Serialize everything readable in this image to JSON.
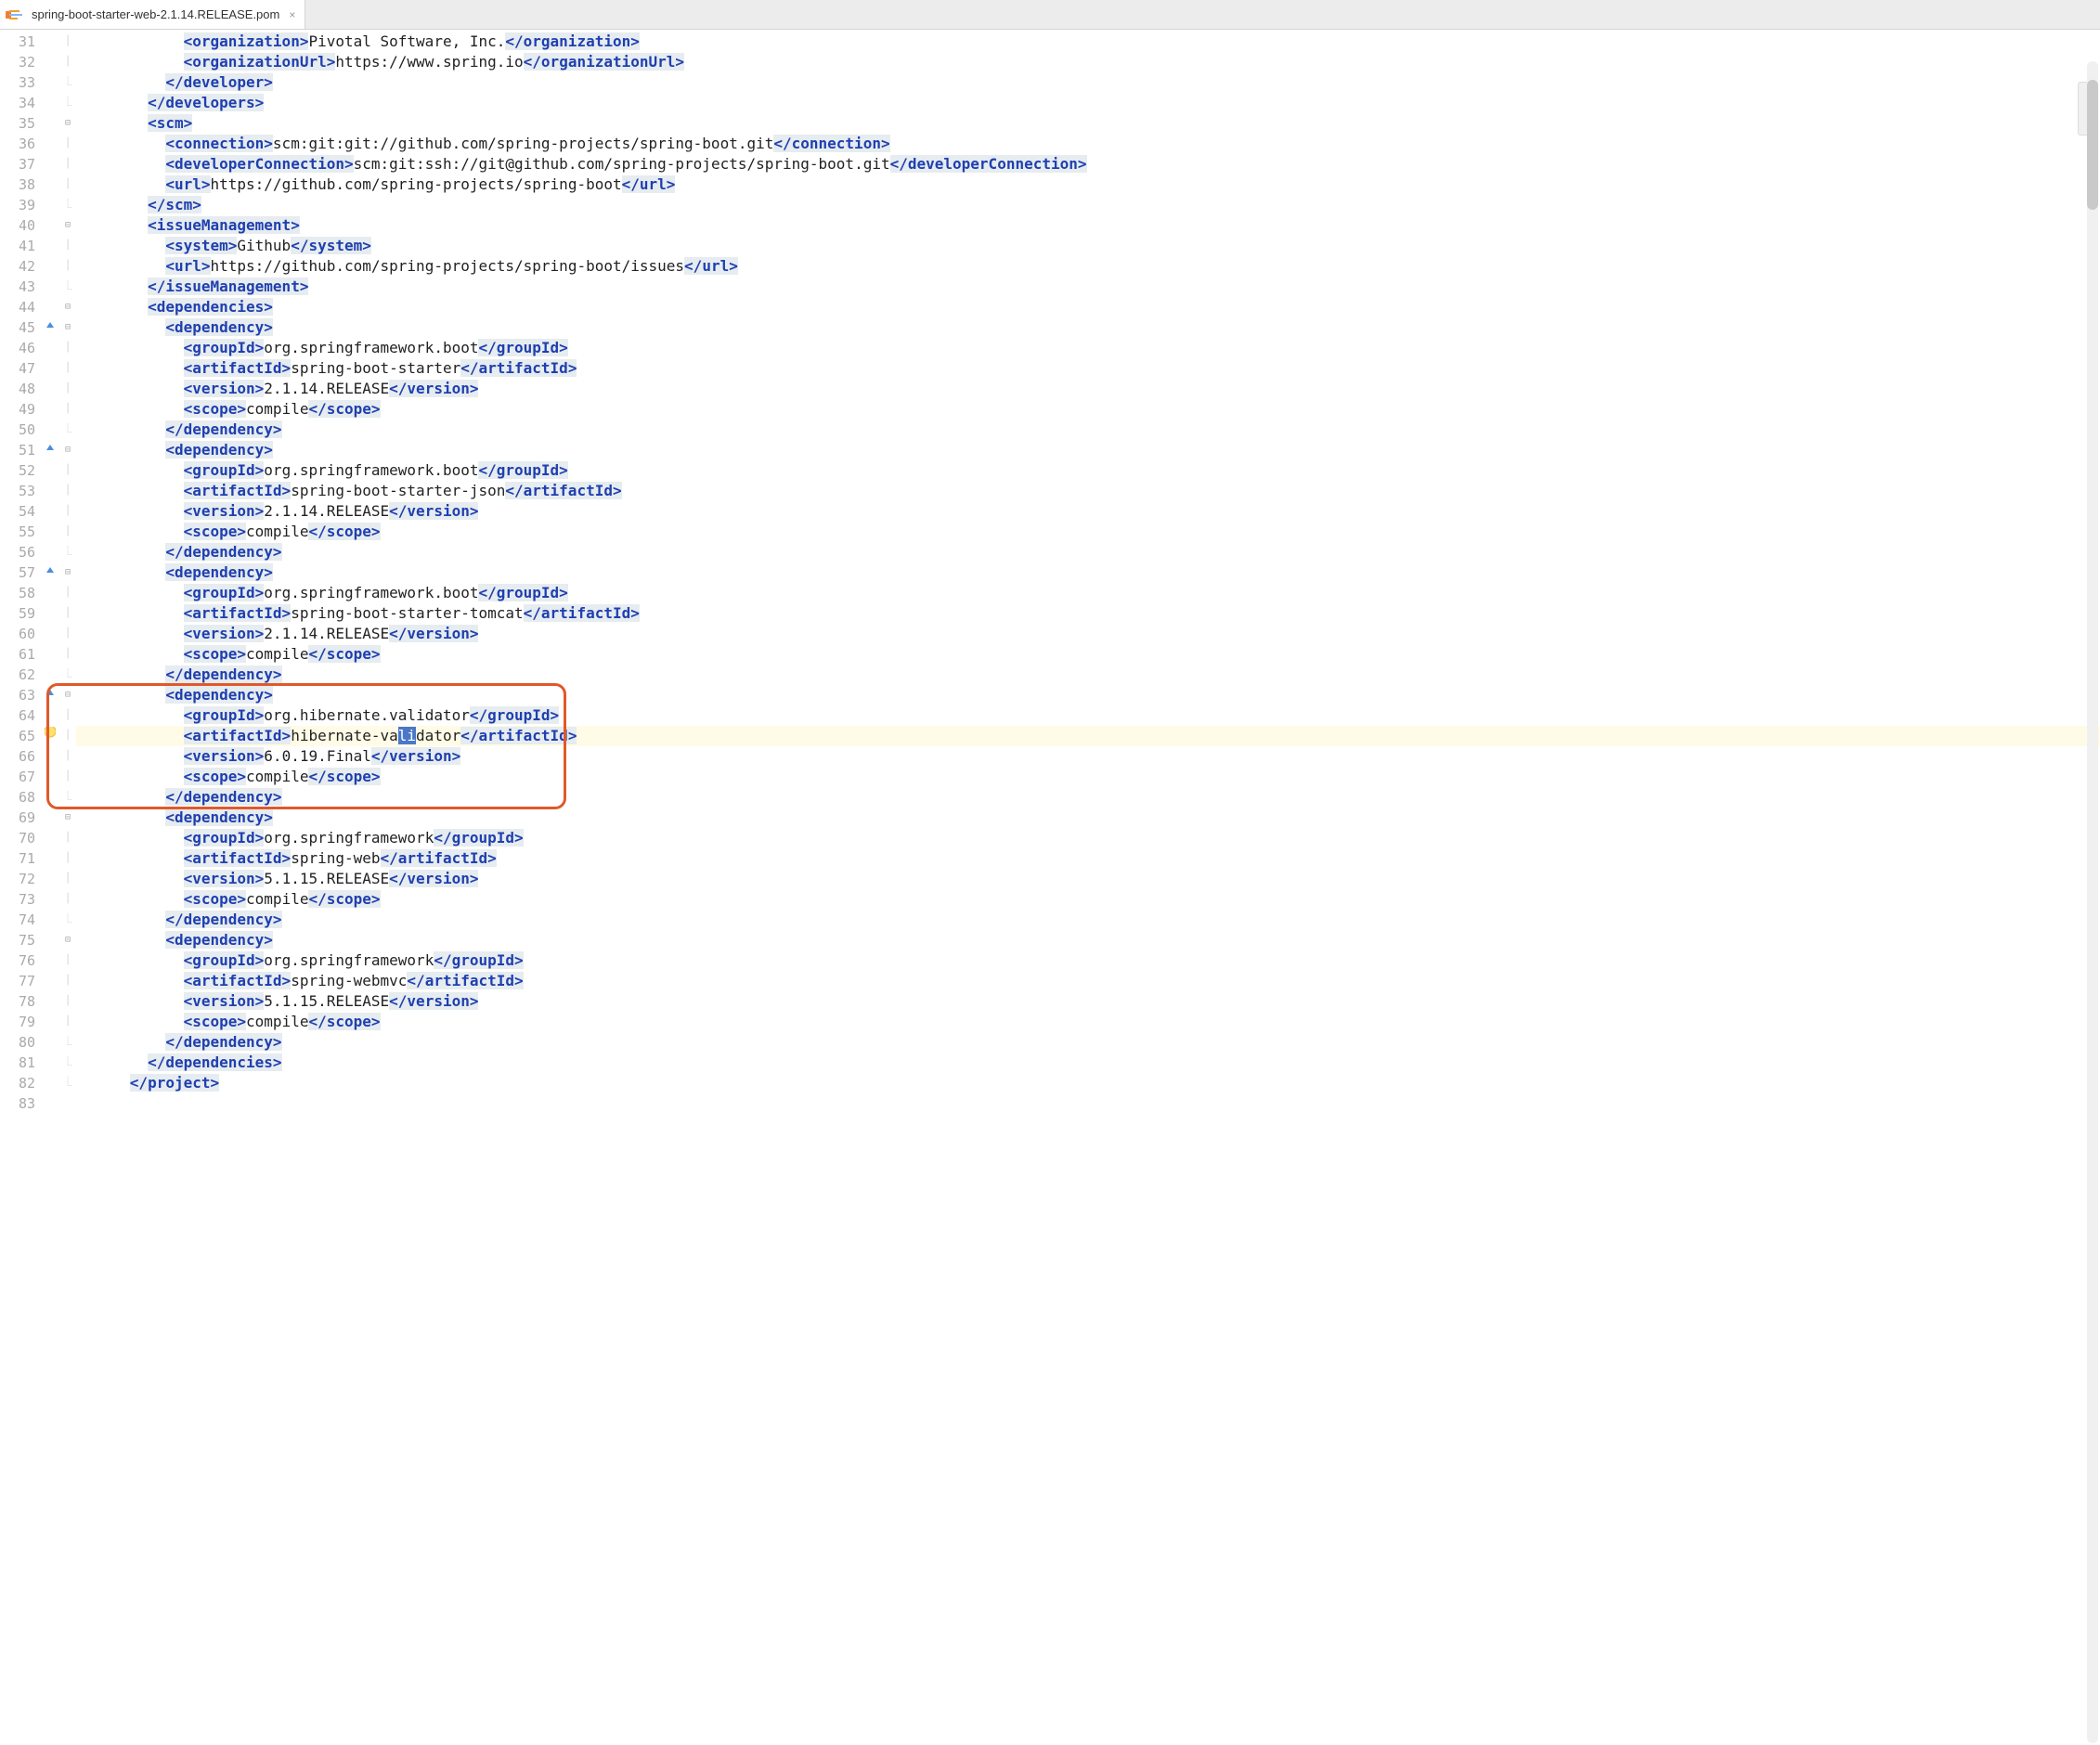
{
  "tab": {
    "title": "spring-boot-starter-web-2.1.14.RELEASE.pom"
  },
  "lines": [
    {
      "n": 31,
      "ind": 6,
      "marker": "",
      "fold": "│",
      "segs": [
        {
          "t": "tag",
          "v": "<organization>"
        },
        {
          "t": "txt",
          "v": "Pivotal Software, Inc."
        },
        {
          "t": "tag",
          "v": "</organization>"
        }
      ]
    },
    {
      "n": 32,
      "ind": 6,
      "marker": "",
      "fold": "│",
      "segs": [
        {
          "t": "tag",
          "v": "<organizationUrl>"
        },
        {
          "t": "txt",
          "v": "https://www.spring.io"
        },
        {
          "t": "tag",
          "v": "</organizationUrl>"
        }
      ]
    },
    {
      "n": 33,
      "ind": 5,
      "marker": "",
      "fold": "└",
      "segs": [
        {
          "t": "tag",
          "v": "</developer>"
        }
      ]
    },
    {
      "n": 34,
      "ind": 4,
      "marker": "",
      "fold": "└",
      "segs": [
        {
          "t": "tag",
          "v": "</developers>"
        }
      ]
    },
    {
      "n": 35,
      "ind": 4,
      "marker": "",
      "fold": "▼",
      "segs": [
        {
          "t": "tag",
          "v": "<scm>"
        }
      ]
    },
    {
      "n": 36,
      "ind": 5,
      "marker": "",
      "fold": "│",
      "segs": [
        {
          "t": "tag",
          "v": "<connection>"
        },
        {
          "t": "txt",
          "v": "scm:git:git://github.com/spring-projects/spring-boot.git"
        },
        {
          "t": "tag",
          "v": "</connection>"
        }
      ]
    },
    {
      "n": 37,
      "ind": 5,
      "marker": "",
      "fold": "│",
      "segs": [
        {
          "t": "tag",
          "v": "<developerConnection>"
        },
        {
          "t": "txt",
          "v": "scm:git:ssh://git@github.com/spring-projects/spring-boot.git"
        },
        {
          "t": "tag",
          "v": "</developerConnection>"
        }
      ]
    },
    {
      "n": 38,
      "ind": 5,
      "marker": "",
      "fold": "│",
      "segs": [
        {
          "t": "tag",
          "v": "<url>"
        },
        {
          "t": "txt",
          "v": "https://github.com/spring-projects/spring-boot"
        },
        {
          "t": "tag",
          "v": "</url>"
        }
      ]
    },
    {
      "n": 39,
      "ind": 4,
      "marker": "",
      "fold": "└",
      "segs": [
        {
          "t": "tag",
          "v": "</scm>"
        }
      ]
    },
    {
      "n": 40,
      "ind": 4,
      "marker": "",
      "fold": "▼",
      "segs": [
        {
          "t": "tag",
          "v": "<issueManagement>"
        }
      ]
    },
    {
      "n": 41,
      "ind": 5,
      "marker": "",
      "fold": "│",
      "segs": [
        {
          "t": "tag",
          "v": "<system>"
        },
        {
          "t": "txt",
          "v": "Github"
        },
        {
          "t": "tag",
          "v": "</system>"
        }
      ]
    },
    {
      "n": 42,
      "ind": 5,
      "marker": "",
      "fold": "│",
      "segs": [
        {
          "t": "tag",
          "v": "<url>"
        },
        {
          "t": "txt",
          "v": "https://github.com/spring-projects/spring-boot/issues"
        },
        {
          "t": "tag",
          "v": "</url>"
        }
      ]
    },
    {
      "n": 43,
      "ind": 4,
      "marker": "",
      "fold": "└",
      "segs": [
        {
          "t": "tag",
          "v": "</issueManagement>"
        }
      ]
    },
    {
      "n": 44,
      "ind": 4,
      "marker": "",
      "fold": "▼",
      "segs": [
        {
          "t": "tag",
          "v": "<dependencies>"
        }
      ]
    },
    {
      "n": 45,
      "ind": 5,
      "marker": "up",
      "fold": "▼",
      "segs": [
        {
          "t": "tag",
          "v": "<dependency>"
        }
      ]
    },
    {
      "n": 46,
      "ind": 6,
      "marker": "",
      "fold": "│",
      "segs": [
        {
          "t": "tag",
          "v": "<groupId>"
        },
        {
          "t": "txt",
          "v": "org.springframework.boot"
        },
        {
          "t": "tag",
          "v": "</groupId>"
        }
      ]
    },
    {
      "n": 47,
      "ind": 6,
      "marker": "",
      "fold": "│",
      "segs": [
        {
          "t": "tag",
          "v": "<artifactId>"
        },
        {
          "t": "txt",
          "v": "spring-boot-starter"
        },
        {
          "t": "tag",
          "v": "</artifactId>"
        }
      ]
    },
    {
      "n": 48,
      "ind": 6,
      "marker": "",
      "fold": "│",
      "segs": [
        {
          "t": "tag",
          "v": "<version>"
        },
        {
          "t": "txt",
          "v": "2.1.14.RELEASE"
        },
        {
          "t": "tag",
          "v": "</version>"
        }
      ]
    },
    {
      "n": 49,
      "ind": 6,
      "marker": "",
      "fold": "│",
      "segs": [
        {
          "t": "tag",
          "v": "<scope>"
        },
        {
          "t": "txt",
          "v": "compile"
        },
        {
          "t": "tag",
          "v": "</scope>"
        }
      ]
    },
    {
      "n": 50,
      "ind": 5,
      "marker": "",
      "fold": "└",
      "segs": [
        {
          "t": "tag",
          "v": "</dependency>"
        }
      ]
    },
    {
      "n": 51,
      "ind": 5,
      "marker": "up",
      "fold": "▼",
      "segs": [
        {
          "t": "tag",
          "v": "<dependency>"
        }
      ]
    },
    {
      "n": 52,
      "ind": 6,
      "marker": "",
      "fold": "│",
      "segs": [
        {
          "t": "tag",
          "v": "<groupId>"
        },
        {
          "t": "txt",
          "v": "org.springframework.boot"
        },
        {
          "t": "tag",
          "v": "</groupId>"
        }
      ]
    },
    {
      "n": 53,
      "ind": 6,
      "marker": "",
      "fold": "│",
      "segs": [
        {
          "t": "tag",
          "v": "<artifactId>"
        },
        {
          "t": "txt",
          "v": "spring-boot-starter-json"
        },
        {
          "t": "tag",
          "v": "</artifactId>"
        }
      ]
    },
    {
      "n": 54,
      "ind": 6,
      "marker": "",
      "fold": "│",
      "segs": [
        {
          "t": "tag",
          "v": "<version>"
        },
        {
          "t": "txt",
          "v": "2.1.14.RELEASE"
        },
        {
          "t": "tag",
          "v": "</version>"
        }
      ]
    },
    {
      "n": 55,
      "ind": 6,
      "marker": "",
      "fold": "│",
      "segs": [
        {
          "t": "tag",
          "v": "<scope>"
        },
        {
          "t": "txt",
          "v": "compile"
        },
        {
          "t": "tag",
          "v": "</scope>"
        }
      ]
    },
    {
      "n": 56,
      "ind": 5,
      "marker": "",
      "fold": "└",
      "segs": [
        {
          "t": "tag",
          "v": "</dependency>"
        }
      ]
    },
    {
      "n": 57,
      "ind": 5,
      "marker": "up",
      "fold": "▼",
      "segs": [
        {
          "t": "tag",
          "v": "<dependency>"
        }
      ]
    },
    {
      "n": 58,
      "ind": 6,
      "marker": "",
      "fold": "│",
      "segs": [
        {
          "t": "tag",
          "v": "<groupId>"
        },
        {
          "t": "txt",
          "v": "org.springframework.boot"
        },
        {
          "t": "tag",
          "v": "</groupId>"
        }
      ]
    },
    {
      "n": 59,
      "ind": 6,
      "marker": "",
      "fold": "│",
      "segs": [
        {
          "t": "tag",
          "v": "<artifactId>"
        },
        {
          "t": "txt",
          "v": "spring-boot-starter-tomcat"
        },
        {
          "t": "tag",
          "v": "</artifactId>"
        }
      ]
    },
    {
      "n": 60,
      "ind": 6,
      "marker": "",
      "fold": "│",
      "segs": [
        {
          "t": "tag",
          "v": "<version>"
        },
        {
          "t": "txt",
          "v": "2.1.14.RELEASE"
        },
        {
          "t": "tag",
          "v": "</version>"
        }
      ]
    },
    {
      "n": 61,
      "ind": 6,
      "marker": "",
      "fold": "│",
      "segs": [
        {
          "t": "tag",
          "v": "<scope>"
        },
        {
          "t": "txt",
          "v": "compile"
        },
        {
          "t": "tag",
          "v": "</scope>"
        }
      ]
    },
    {
      "n": 62,
      "ind": 5,
      "marker": "",
      "fold": "└",
      "segs": [
        {
          "t": "tag",
          "v": "</dependency>"
        }
      ]
    },
    {
      "n": 63,
      "ind": 5,
      "marker": "up",
      "fold": "▼",
      "segs": [
        {
          "t": "tag",
          "v": "<dependency>"
        }
      ]
    },
    {
      "n": 64,
      "ind": 6,
      "marker": "",
      "fold": "│",
      "segs": [
        {
          "t": "tag",
          "v": "<groupId>"
        },
        {
          "t": "txt",
          "v": "org.hibernate.validator"
        },
        {
          "t": "tag",
          "v": "</groupId>"
        }
      ]
    },
    {
      "n": 65,
      "ind": 6,
      "marker": "bulb",
      "fold": "│",
      "hl": true,
      "segs": [
        {
          "t": "tag",
          "v": "<artifactId>"
        },
        {
          "t": "txt",
          "v": "hibernate-va"
        },
        {
          "t": "sel",
          "v": "li"
        },
        {
          "t": "txt",
          "v": "dator"
        },
        {
          "t": "tag",
          "v": "</artifactId>"
        }
      ]
    },
    {
      "n": 66,
      "ind": 6,
      "marker": "",
      "fold": "│",
      "segs": [
        {
          "t": "tag",
          "v": "<version>"
        },
        {
          "t": "txt",
          "v": "6.0.19.Final"
        },
        {
          "t": "tag",
          "v": "</version>"
        }
      ]
    },
    {
      "n": 67,
      "ind": 6,
      "marker": "",
      "fold": "│",
      "segs": [
        {
          "t": "tag",
          "v": "<scope>"
        },
        {
          "t": "txt",
          "v": "compile"
        },
        {
          "t": "tag",
          "v": "</scope>"
        }
      ]
    },
    {
      "n": 68,
      "ind": 5,
      "marker": "",
      "fold": "└",
      "segs": [
        {
          "t": "tag",
          "v": "</dependency>"
        }
      ]
    },
    {
      "n": 69,
      "ind": 5,
      "marker": "",
      "fold": "▼",
      "segs": [
        {
          "t": "tag",
          "v": "<dependency>"
        }
      ]
    },
    {
      "n": 70,
      "ind": 6,
      "marker": "",
      "fold": "│",
      "segs": [
        {
          "t": "tag",
          "v": "<groupId>"
        },
        {
          "t": "txt",
          "v": "org.springframework"
        },
        {
          "t": "tag",
          "v": "</groupId>"
        }
      ]
    },
    {
      "n": 71,
      "ind": 6,
      "marker": "",
      "fold": "│",
      "segs": [
        {
          "t": "tag",
          "v": "<artifactId>"
        },
        {
          "t": "txt",
          "v": "spring-web"
        },
        {
          "t": "tag",
          "v": "</artifactId>"
        }
      ]
    },
    {
      "n": 72,
      "ind": 6,
      "marker": "",
      "fold": "│",
      "segs": [
        {
          "t": "tag",
          "v": "<version>"
        },
        {
          "t": "txt",
          "v": "5.1.15.RELEASE"
        },
        {
          "t": "tag",
          "v": "</version>"
        }
      ]
    },
    {
      "n": 73,
      "ind": 6,
      "marker": "",
      "fold": "│",
      "segs": [
        {
          "t": "tag",
          "v": "<scope>"
        },
        {
          "t": "txt",
          "v": "compile"
        },
        {
          "t": "tag",
          "v": "</scope>"
        }
      ]
    },
    {
      "n": 74,
      "ind": 5,
      "marker": "",
      "fold": "└",
      "segs": [
        {
          "t": "tag",
          "v": "</dependency>"
        }
      ]
    },
    {
      "n": 75,
      "ind": 5,
      "marker": "",
      "fold": "▼",
      "segs": [
        {
          "t": "tag",
          "v": "<dependency>"
        }
      ]
    },
    {
      "n": 76,
      "ind": 6,
      "marker": "",
      "fold": "│",
      "segs": [
        {
          "t": "tag",
          "v": "<groupId>"
        },
        {
          "t": "txt",
          "v": "org.springframework"
        },
        {
          "t": "tag",
          "v": "</groupId>"
        }
      ]
    },
    {
      "n": 77,
      "ind": 6,
      "marker": "",
      "fold": "│",
      "segs": [
        {
          "t": "tag",
          "v": "<artifactId>"
        },
        {
          "t": "txt",
          "v": "spring-webmvc"
        },
        {
          "t": "tag",
          "v": "</artifactId>"
        }
      ]
    },
    {
      "n": 78,
      "ind": 6,
      "marker": "",
      "fold": "│",
      "segs": [
        {
          "t": "tag",
          "v": "<version>"
        },
        {
          "t": "txt",
          "v": "5.1.15.RELEASE"
        },
        {
          "t": "tag",
          "v": "</version>"
        }
      ]
    },
    {
      "n": 79,
      "ind": 6,
      "marker": "",
      "fold": "│",
      "segs": [
        {
          "t": "tag",
          "v": "<scope>"
        },
        {
          "t": "txt",
          "v": "compile"
        },
        {
          "t": "tag",
          "v": "</scope>"
        }
      ]
    },
    {
      "n": 80,
      "ind": 5,
      "marker": "",
      "fold": "└",
      "segs": [
        {
          "t": "tag",
          "v": "</dependency>"
        }
      ]
    },
    {
      "n": 81,
      "ind": 4,
      "marker": "",
      "fold": "└",
      "segs": [
        {
          "t": "tag",
          "v": "</dependencies>"
        }
      ]
    },
    {
      "n": 82,
      "ind": 3,
      "marker": "",
      "fold": "└",
      "segs": [
        {
          "t": "tag",
          "v": "</project>"
        }
      ]
    },
    {
      "n": 83,
      "ind": 0,
      "marker": "",
      "fold": "",
      "segs": []
    }
  ],
  "highlight_box": {
    "from_line": 63,
    "to_line": 68
  }
}
